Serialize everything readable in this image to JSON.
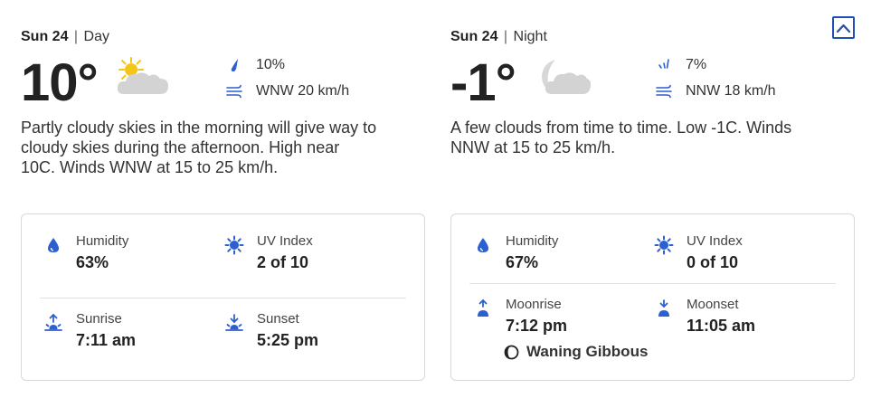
{
  "day": {
    "date": "Sun 24",
    "separator": "|",
    "part": "Day",
    "temp": "10°",
    "weather_icon": "partly-cloudy-day-icon",
    "precip_icon": "raindrop-icon",
    "precip": "10%",
    "wind_icon": "wind-icon",
    "wind": "WNW 20 km/h",
    "summary": "Partly cloudy skies in the morning will give way to cloudy skies during the afternoon. High near 10C. Winds WNW at 15 to 25 km/h.",
    "details": {
      "humidity_label": "Humidity",
      "humidity": "63%",
      "uv_label": "UV Index",
      "uv": "2 of 10",
      "rise_label": "Sunrise",
      "rise": "7:11 am",
      "set_label": "Sunset",
      "set": "5:25 pm"
    }
  },
  "night": {
    "date": "Sun 24",
    "separator": "|",
    "part": "Night",
    "temp": "-1°",
    "weather_icon": "partly-cloudy-night-icon",
    "precip_icon": "rain-streaks-icon",
    "precip": "7%",
    "wind_icon": "wind-icon",
    "wind": "NNW 18 km/h",
    "summary": "A few clouds from time to time. Low -1C. Winds NNW at 15 to 25 km/h.",
    "details": {
      "humidity_label": "Humidity",
      "humidity": "67%",
      "uv_label": "UV Index",
      "uv": "0 of 10",
      "rise_label": "Moonrise",
      "rise": "7:12 pm",
      "set_label": "Moonset",
      "set": "11:05 am",
      "moon_phase": "Waning Gibbous"
    }
  },
  "collapse_icon": "chevron-up-icon",
  "colors": {
    "accent": "#1f4fb5",
    "sun": "#f5c518",
    "cloud": "#cfcfcf"
  }
}
